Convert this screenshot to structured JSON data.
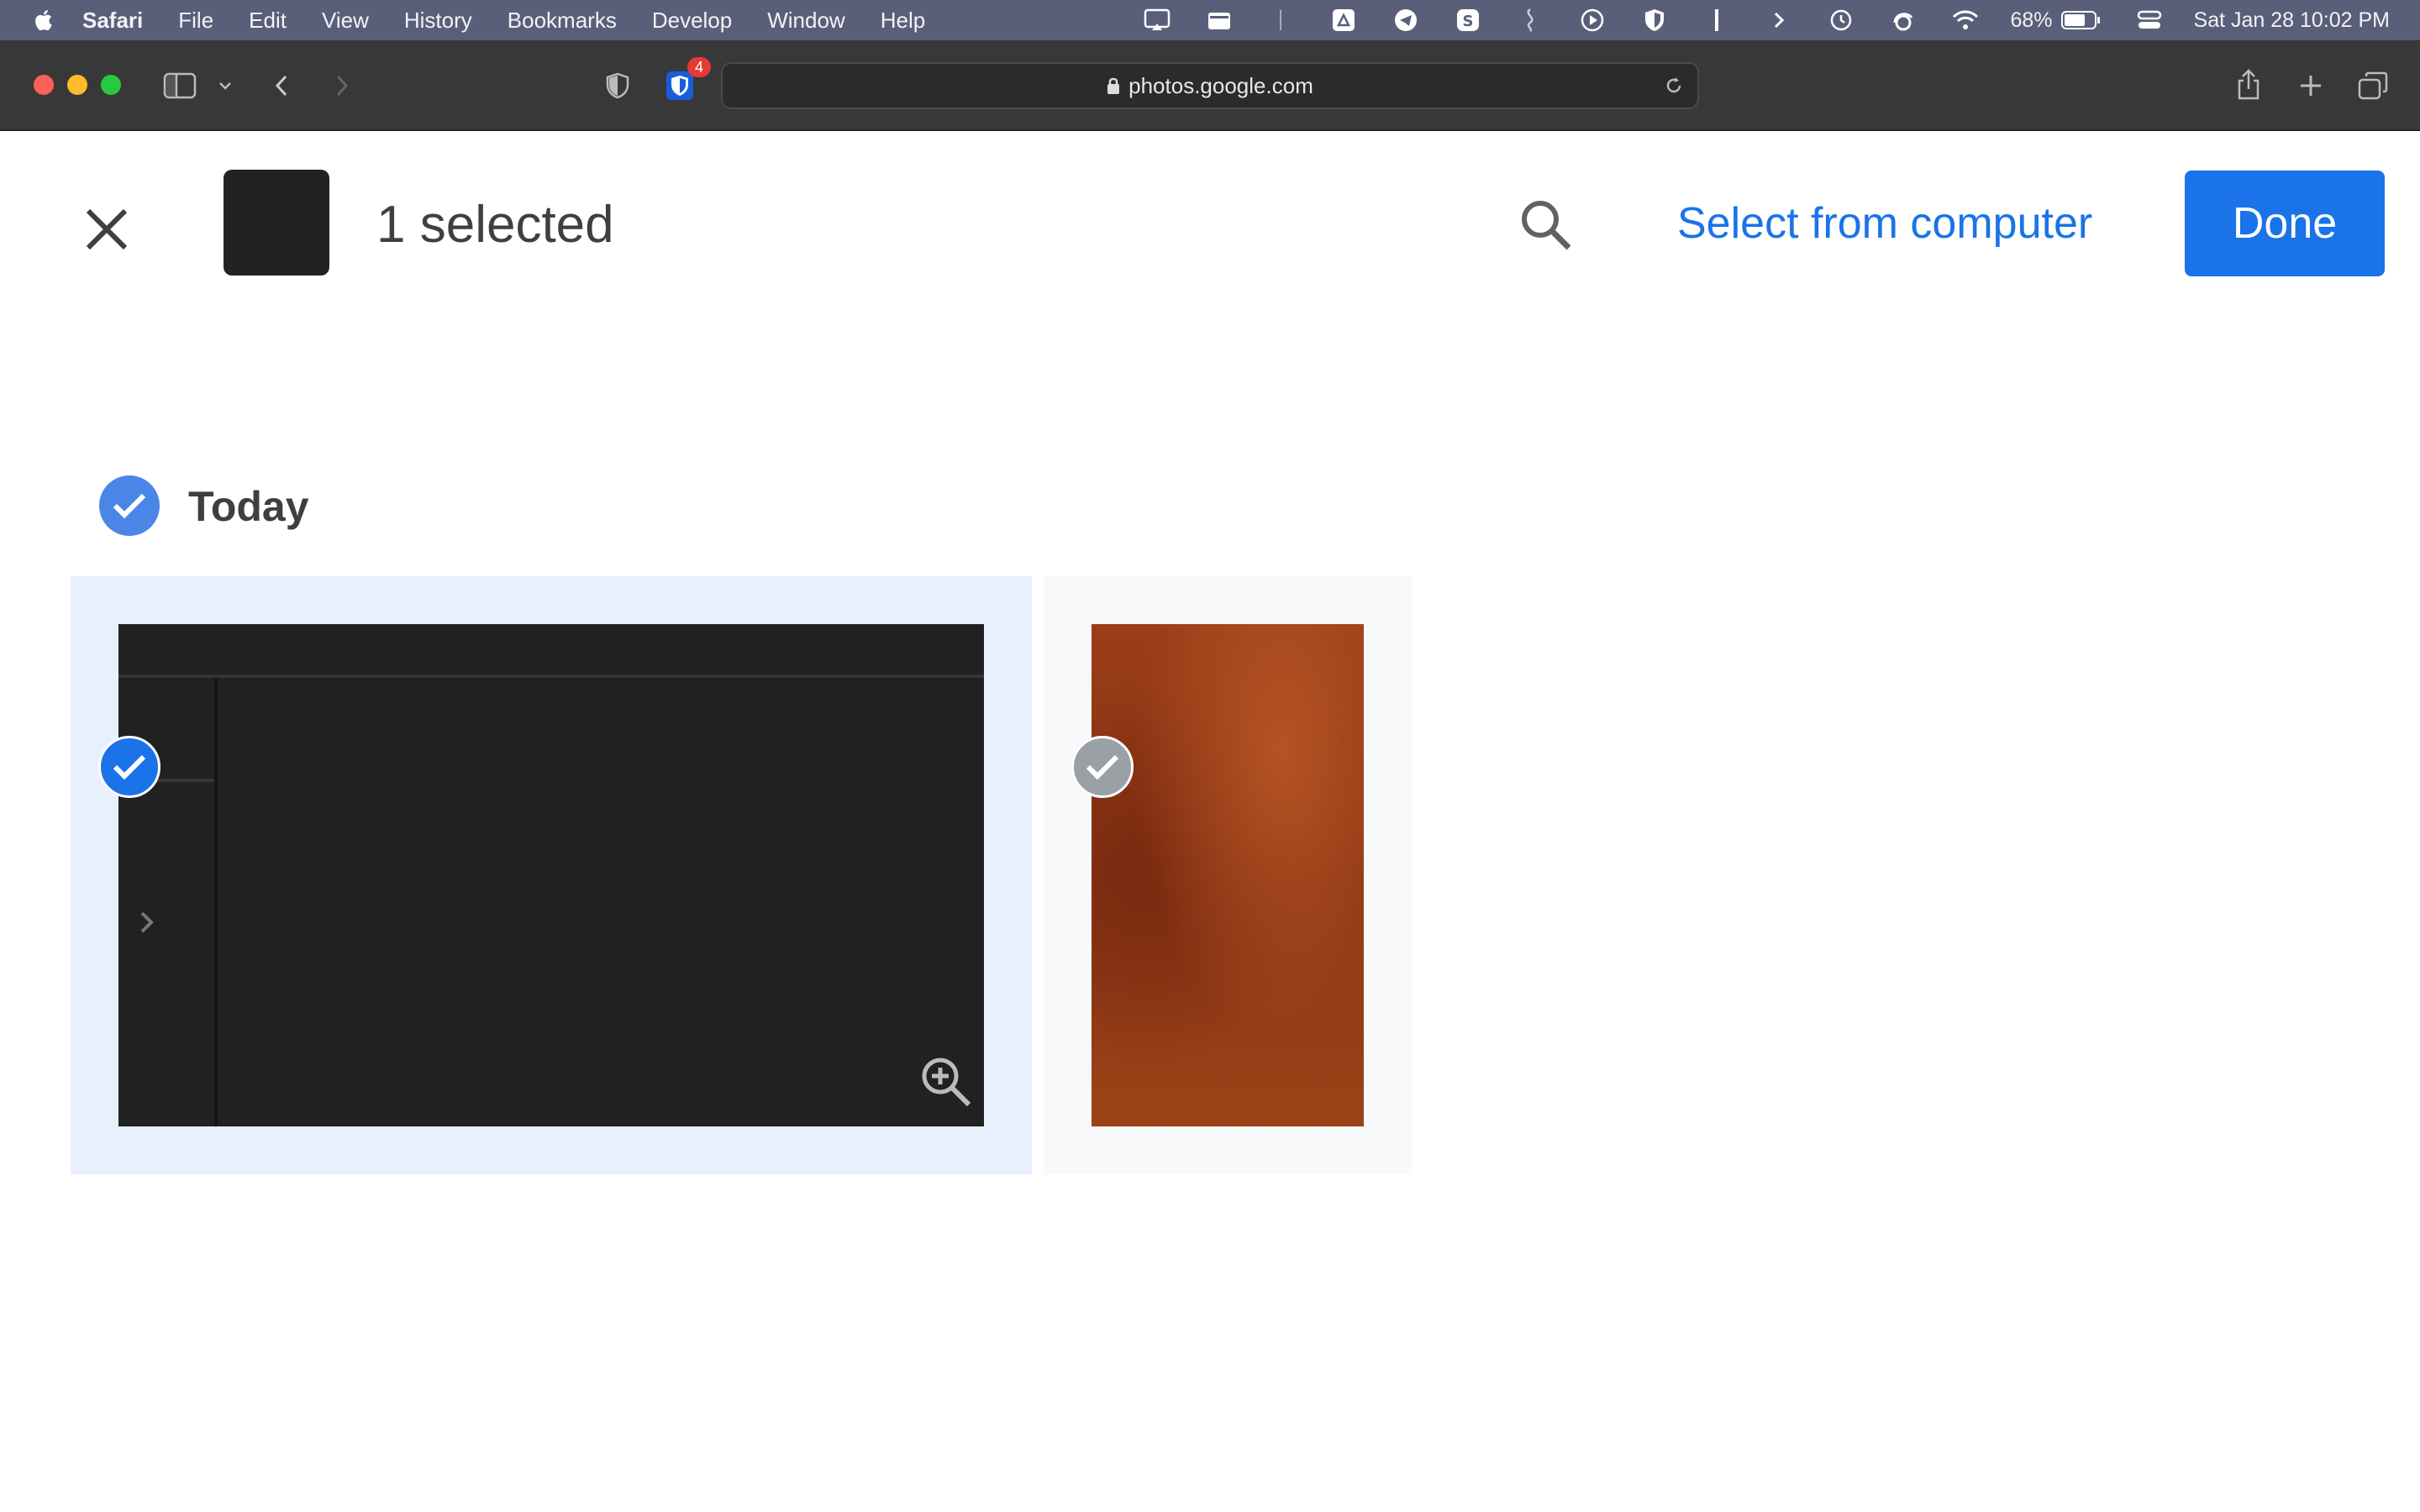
{
  "menubar": {
    "app_name": "Safari",
    "items": [
      "File",
      "Edit",
      "View",
      "History",
      "Bookmarks",
      "Develop",
      "Window",
      "Help"
    ],
    "battery": "68%",
    "datetime": "Sat Jan 28  10:02 PM"
  },
  "browser": {
    "url": "photos.google.com",
    "extension_badge": "4"
  },
  "header": {
    "selected_count": "1 selected",
    "select_from_computer": "Select from computer",
    "done_label": "Done"
  },
  "section": {
    "title": "Today"
  },
  "photos": [
    {
      "selected": true,
      "kind": "screenshot"
    },
    {
      "selected": false,
      "kind": "orange-texture"
    }
  ],
  "colors": {
    "accent": "#1a73e8",
    "selected_tile_bg": "#e8f0fe",
    "menubar_bg": "#5a5f79",
    "toolbar_bg": "#383838"
  }
}
